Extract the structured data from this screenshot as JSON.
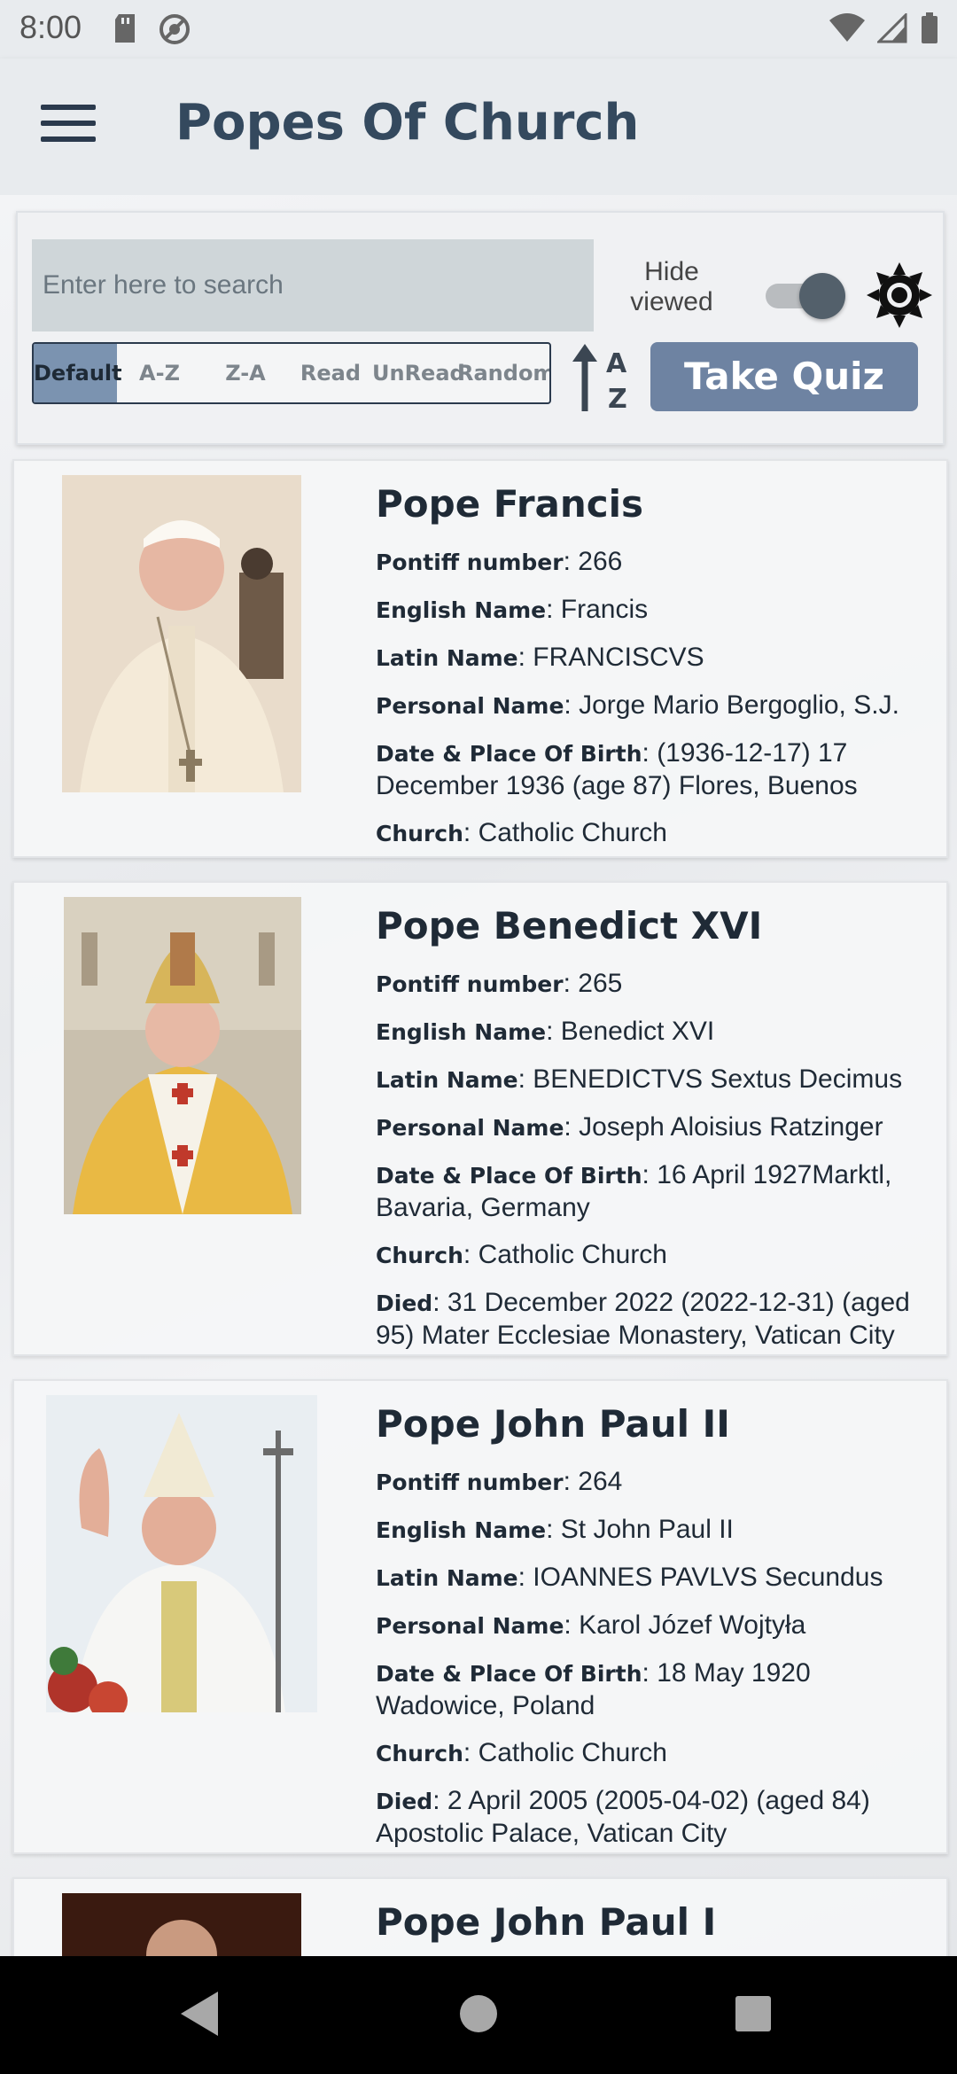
{
  "status": {
    "time": "8:00"
  },
  "app_bar": {
    "title": "Popes Of Church"
  },
  "controls": {
    "search_placeholder": "Enter here to search",
    "hide_viewed_label": "Hide viewed",
    "hide_viewed_on": true,
    "sort_options": [
      "Default",
      "A-Z",
      "Z-A",
      "Read",
      "UnRead",
      "Random"
    ],
    "sort_selected": "Default",
    "quiz_label": "Take Quiz"
  },
  "field_labels": {
    "pontiff_number": "Pontiff number",
    "english_name": "English Name",
    "latin_name": "Latin Name",
    "personal_name": "Personal Name",
    "birth": "Date & Place Of Birth",
    "church": "Church",
    "died": "Died"
  },
  "popes": [
    {
      "name": "Pope Francis",
      "pontiff_number": "266",
      "english_name": "Francis",
      "latin_name": "FRANCISCVS",
      "personal_name": "Jorge Mario Bergoglio, S.J.",
      "birth": "(1936-12-17) 17 December 1936 (age 87) Flores, Buenos",
      "church": "Catholic Church"
    },
    {
      "name": "Pope Benedict XVI",
      "pontiff_number": "265",
      "english_name": "Benedict XVI",
      "latin_name": "BENEDICTVS Sextus Decimus",
      "personal_name": "Joseph Aloisius Ratzinger",
      "birth": "16 April 1927Marktl, Bavaria, Germany",
      "church": "Catholic Church",
      "died": "31 December 2022 (2022-12-31) (aged 95) Mater Ecclesiae Monastery, Vatican City"
    },
    {
      "name": "Pope John Paul II",
      "pontiff_number": "264",
      "english_name": "St John Paul II",
      "latin_name": "IOANNES PAVLVS Secundus",
      "personal_name": "Karol Józef Wojtyła",
      "birth": "18 May 1920 Wadowice, Poland",
      "church": "Catholic Church",
      "died": "2 April 2005 (2005-04-02) (aged 84) Apostolic Palace, Vatican City"
    },
    {
      "name": "Pope John Paul I"
    }
  ],
  "colors": {
    "app_bar_bg": "#e8ebee",
    "title": "#34495e",
    "accent": "#6e83a2",
    "sort_active": "#7b93b0"
  }
}
